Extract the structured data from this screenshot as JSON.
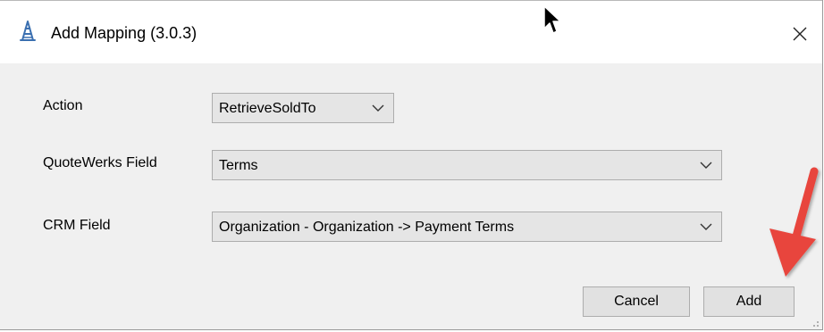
{
  "window": {
    "title": "Add Mapping (3.0.3)",
    "close_glyph": "✕"
  },
  "form": {
    "action": {
      "label": "Action",
      "value": "RetrieveSoldTo"
    },
    "quotewerks_field": {
      "label": "QuoteWerks Field",
      "value": "Terms"
    },
    "crm_field": {
      "label": "CRM Field",
      "value": "Organization - Organization -> Payment Terms"
    }
  },
  "buttons": {
    "cancel_label": "Cancel",
    "add_label": "Add"
  },
  "icons": {
    "app": "oil-rig-icon",
    "dropdown": "chevron-down-icon",
    "mouse": "mouse-cursor-icon",
    "annotation": "red-arrow-icon"
  },
  "colors": {
    "annotation_arrow": "#e8453c",
    "app_icon": "#3a6fb0"
  }
}
